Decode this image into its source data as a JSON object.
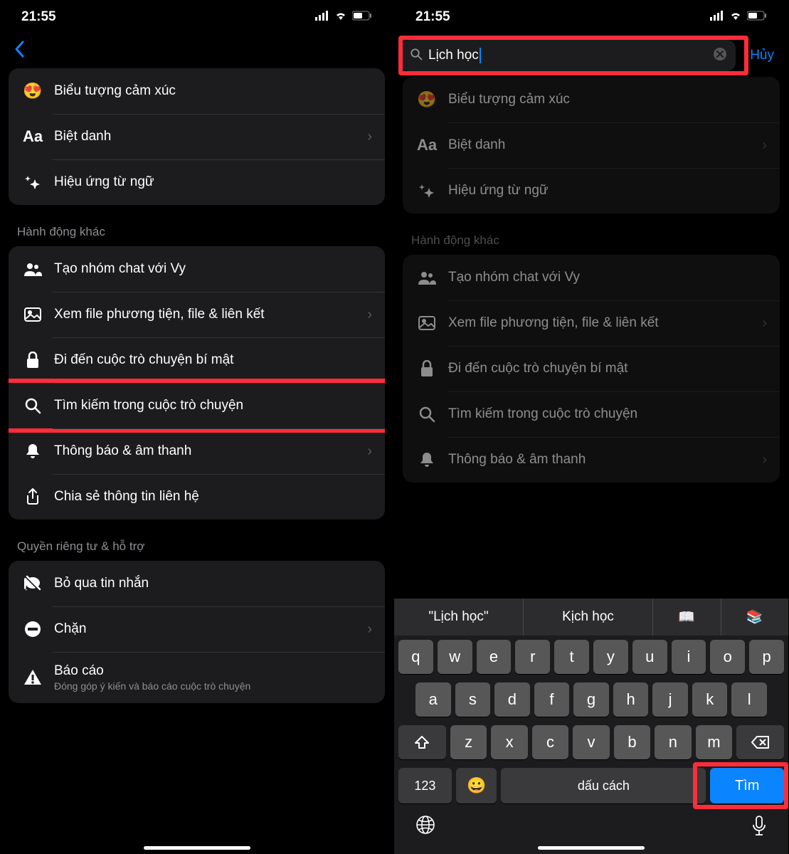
{
  "status": {
    "time": "21:55"
  },
  "left": {
    "rows1": [
      {
        "icon": "😍",
        "label": "Biểu tượng cảm xúc",
        "chev": false
      },
      {
        "icon": "Aa",
        "label": "Biệt danh",
        "chev": true
      },
      {
        "icon": "✨",
        "label": "Hiệu ứng từ ngữ",
        "chev": false
      }
    ],
    "section2_header": "Hành động khác",
    "rows2": [
      {
        "icon": "group",
        "label": "Tạo nhóm chat với Vy",
        "chev": false
      },
      {
        "icon": "image",
        "label": "Xem file phương tiện, file & liên kết",
        "chev": true
      },
      {
        "icon": "lock",
        "label": "Đi đến cuộc trò chuyện bí mật",
        "chev": false
      },
      {
        "icon": "search",
        "label": "Tìm kiếm trong cuộc trò chuyện",
        "chev": false,
        "highlight": true
      },
      {
        "icon": "bell",
        "label": "Thông báo & âm thanh",
        "chev": true
      },
      {
        "icon": "share",
        "label": "Chia sẻ thông tin liên hệ",
        "chev": false
      }
    ],
    "section3_header": "Quyền riêng tư & hỗ trợ",
    "rows3": [
      {
        "icon": "mute",
        "label": "Bỏ qua tin nhắn",
        "chev": false
      },
      {
        "icon": "block",
        "label": "Chặn",
        "chev": true
      },
      {
        "icon": "warn",
        "label": "Báo cáo",
        "sub": "Đóng góp ý kiến và báo cáo cuộc trò chuyện",
        "chev": false
      }
    ]
  },
  "right": {
    "search_value": "Lịch học",
    "cancel": "Hủy",
    "rows1": [
      {
        "icon": "😍",
        "label": "Biểu tượng cảm xúc",
        "chev": false
      },
      {
        "icon": "Aa",
        "label": "Biệt danh",
        "chev": true
      },
      {
        "icon": "✨",
        "label": "Hiệu ứng từ ngữ",
        "chev": false
      }
    ],
    "section2_header": "Hành động khác",
    "rows2": [
      {
        "icon": "group",
        "label": "Tạo nhóm chat với Vy",
        "chev": false
      },
      {
        "icon": "image",
        "label": "Xem file phương tiện, file & liên kết",
        "chev": true
      },
      {
        "icon": "lock",
        "label": "Đi đến cuộc trò chuyện bí mật",
        "chev": false
      },
      {
        "icon": "search",
        "label": "Tìm kiếm trong cuộc trò chuyện",
        "chev": false
      },
      {
        "icon": "bell",
        "label": "Thông báo & âm thanh",
        "chev": true
      }
    ]
  },
  "keyboard": {
    "suggestions": [
      "\"Lịch học\"",
      "Kịch học",
      "📖",
      "📚"
    ],
    "row1": [
      "q",
      "w",
      "e",
      "r",
      "t",
      "y",
      "u",
      "i",
      "o",
      "p"
    ],
    "row2": [
      "a",
      "s",
      "d",
      "f",
      "g",
      "h",
      "j",
      "k",
      "l"
    ],
    "row3": [
      "z",
      "x",
      "c",
      "v",
      "b",
      "n",
      "m"
    ],
    "num": "123",
    "space": "dấu cách",
    "search": "Tìm"
  }
}
